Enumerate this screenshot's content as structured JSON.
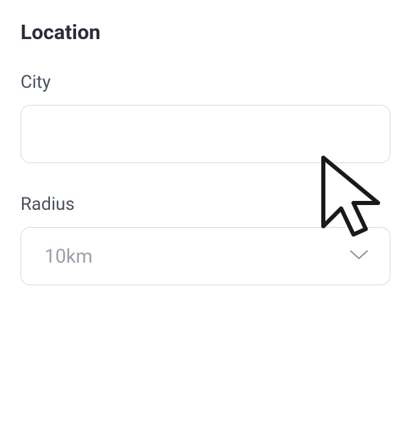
{
  "section": {
    "title": "Location"
  },
  "city": {
    "label": "City",
    "value": ""
  },
  "radius": {
    "label": "Radius",
    "selected": "10km"
  }
}
